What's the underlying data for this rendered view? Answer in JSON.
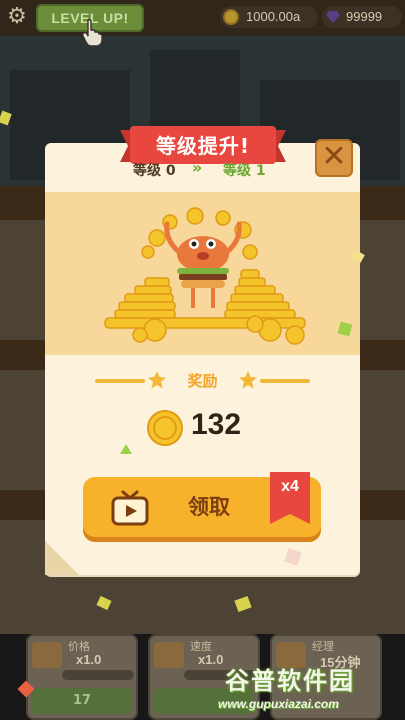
{
  "hud": {
    "level_up_label": "LEVEL UP!",
    "coins": "1000.00a",
    "gems": "99999"
  },
  "dialog": {
    "title": "等级提升!",
    "close_symbol": "✕",
    "level_from": "等级 0",
    "level_arrows": "»",
    "level_to": "等级 1",
    "reward_label": "奖励",
    "reward_amount": "132",
    "claim_label": "领取",
    "multiplier": "x4"
  },
  "bottom_cards": [
    {
      "title": "价格",
      "multiplier": "x1.0",
      "progress": "",
      "button": "17"
    },
    {
      "title": "速度",
      "multiplier": "x1.0",
      "progress": "",
      "button": ""
    },
    {
      "title": "经理",
      "multiplier": "15分钟",
      "progress": "",
      "button": ""
    }
  ],
  "watermark": {
    "title": "谷普软件园",
    "url": "www.gupuxiazai.com"
  },
  "colors": {
    "ribbon": "#e8473f",
    "claim_button": "#f7b12a",
    "accent_green": "#6aa630",
    "dialog_bg": "#fdf3dc"
  },
  "icons": [
    "settings-gear-icon",
    "pointing-hand-icon",
    "coin-icon",
    "gem-icon",
    "close-icon",
    "star-icon",
    "tv-video-icon"
  ]
}
